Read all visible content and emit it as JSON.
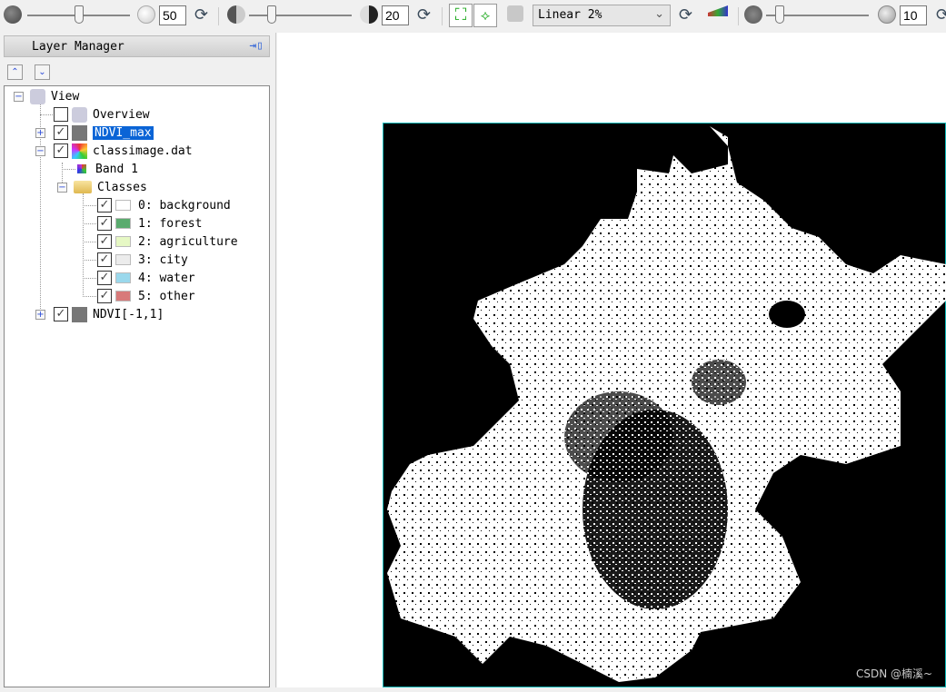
{
  "toolbar": {
    "brightness_value": "50",
    "brightness_level": 50,
    "contrast_value": "20",
    "contrast_level": 20,
    "stretch_select": "Linear 2%",
    "sharpen_value": "10",
    "sharpen_level": 10
  },
  "layer_manager": {
    "title": "Layer Manager",
    "tree": {
      "root": "View",
      "overview": "Overview",
      "ndvi_max": "NDVI_max",
      "classimage": "classimage.dat",
      "band": "Band 1",
      "classes": "Classes",
      "class_items": [
        {
          "label": "0: background",
          "color": "#ffffff"
        },
        {
          "label": "1: forest",
          "color": "#5aab6e"
        },
        {
          "label": "2: agriculture",
          "color": "#e6f8c4"
        },
        {
          "label": "3: city",
          "color": "#ececec"
        },
        {
          "label": "4: water",
          "color": "#9ad8ec"
        },
        {
          "label": "5: other",
          "color": "#d87a7a"
        }
      ],
      "ndvi_range": "NDVI[-1,1]"
    }
  },
  "watermark": "CSDN @楠溪~",
  "colors": {
    "selection": "#0a64d6",
    "map_border": "#11bbbb"
  }
}
